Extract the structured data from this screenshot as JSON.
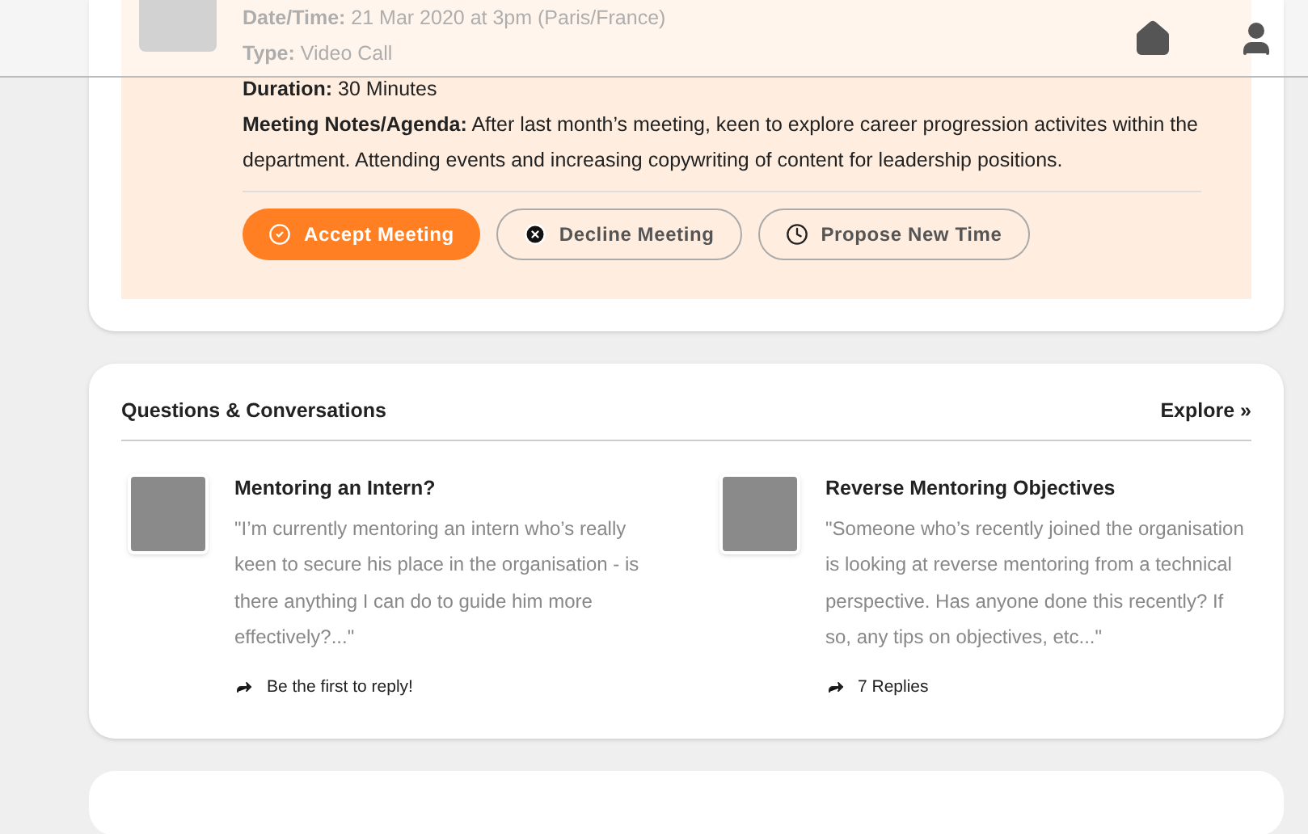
{
  "meeting": {
    "details": [
      {
        "label": "Date/Time:",
        "value": "21 Mar 2020 at 3pm (Paris/France)"
      },
      {
        "label": "Type:",
        "value": "Video Call"
      },
      {
        "label": "Duration:",
        "value": "30 Minutes"
      }
    ],
    "notes": {
      "label": "Meeting Notes/Agenda:",
      "value": "After last month’s meeting, keen to explore career progression activites within the department. Attending events and increasing copywriting of content for leadership positions."
    },
    "actions": [
      {
        "kind": "accept",
        "label": "Accept Meeting"
      },
      {
        "kind": "decline",
        "label": "Decline Meeting"
      },
      {
        "kind": "propose",
        "label": "Propose New Time"
      }
    ]
  },
  "questions": {
    "title": "Questions & Conversations",
    "explore": "Explore »",
    "items": [
      {
        "title": "Mentoring an Intern?",
        "excerpt": "\"I’m currently mentoring an intern who’s really keen to secure his place in the organisation - is there anything I can do to guide him more effectively?...\"",
        "replies": "Be the first to reply!"
      },
      {
        "title": "Reverse Mentoring Objectives",
        "excerpt": "\"Someone who’s recently joined the organisation is looking at reverse mentoring from a technical perspective. Has anyone done this recently? If so, any tips on objectives, etc...\"",
        "replies": "7 Replies"
      }
    ]
  }
}
